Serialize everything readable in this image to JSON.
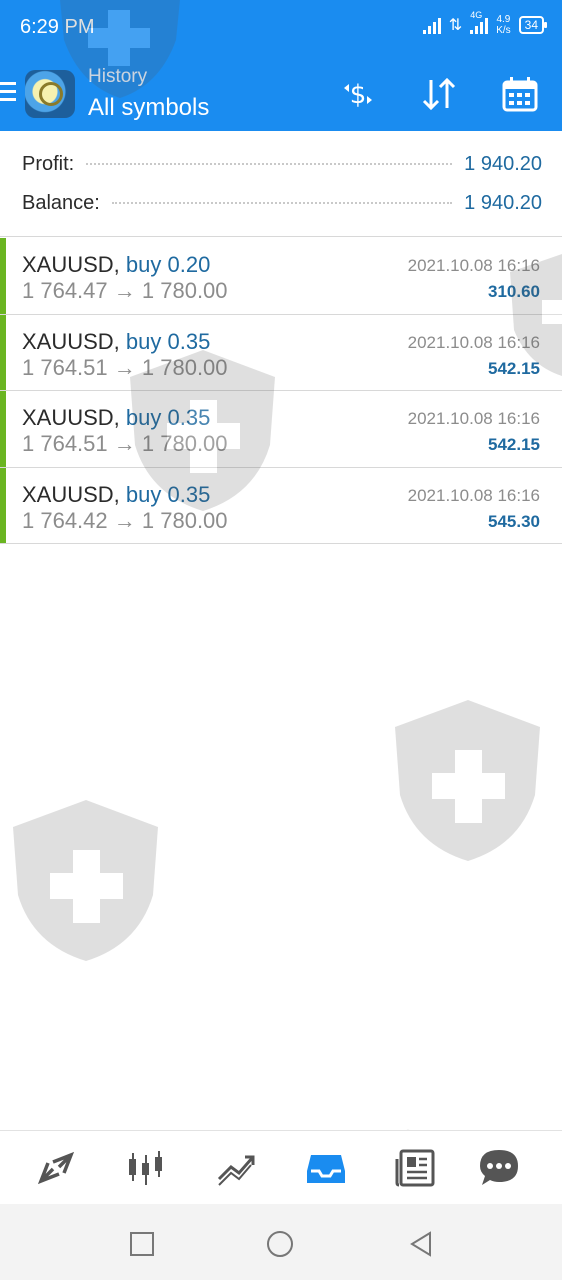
{
  "status_bar": {
    "time": "6:29 PM",
    "network_type": "4G",
    "net_speed_value": "4.9",
    "net_speed_unit": "K/s",
    "battery": "34"
  },
  "app_bar": {
    "subtitle": "History",
    "title": "All symbols",
    "icons": [
      "menu-icon",
      "currency-exchange-icon",
      "sort-icon",
      "calendar-icon"
    ]
  },
  "summary": {
    "profit_label": "Profit:",
    "profit_value": "1 940.20",
    "balance_label": "Balance:",
    "balance_value": "1 940.20"
  },
  "deals": [
    {
      "symbol": "XAUUSD,",
      "side": "buy 0.20",
      "open_price": "1 764.47",
      "arrow": "→",
      "close_price": "1 780.00",
      "time": "2021.10.08 16:16",
      "profit": "310.60"
    },
    {
      "symbol": "XAUUSD,",
      "side": "buy 0.35",
      "open_price": "1 764.51",
      "arrow": "→",
      "close_price": "1 780.00",
      "time": "2021.10.08 16:16",
      "profit": "542.15"
    },
    {
      "symbol": "XAUUSD,",
      "side": "buy 0.35",
      "open_price": "1 764.51",
      "arrow": "→",
      "close_price": "1 780.00",
      "time": "2021.10.08 16:16",
      "profit": "542.15"
    },
    {
      "symbol": "XAUUSD,",
      "side": "buy 0.35",
      "open_price": "1 764.42",
      "arrow": "→",
      "close_price": "1 780.00",
      "time": "2021.10.08 16:16",
      "profit": "545.30"
    }
  ],
  "colors": {
    "accent": "#1a8cf0",
    "profit_text": "#1f6aa0",
    "buy_bar": "#6ab521"
  },
  "bottom_nav": {
    "items": [
      "quotes-icon",
      "chart-icon",
      "trade-icon",
      "history-icon",
      "news-icon",
      "messages-icon"
    ],
    "active": "history-icon"
  },
  "system_nav": [
    "recent-apps-icon",
    "home-icon",
    "back-icon"
  ]
}
